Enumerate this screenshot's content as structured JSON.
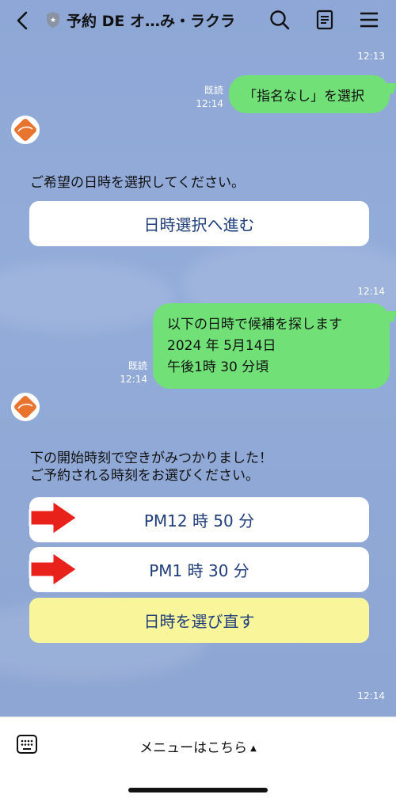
{
  "header": {
    "title": "予約 DE オ…み・ラクラ",
    "icons": [
      "back-icon",
      "shield-icon",
      "search-icon",
      "notes-icon",
      "menu-icon"
    ]
  },
  "messages": {
    "ts_top": "12:13",
    "sent1": {
      "read": "既読",
      "time": "12:14",
      "text": "「指名なし」を選択"
    },
    "bot1": {
      "text": "ご希望の日時を選択してください。",
      "button": "日時選択へ進む"
    },
    "ts_mid": "12:14",
    "sent2": {
      "read": "既読",
      "time": "12:14",
      "line1": "以下の日時で候補を探します",
      "line2": "2024 年 5月14日",
      "line3": "午後1時 30 分頃"
    },
    "bot2": {
      "line1": "下の開始時刻で空きがみつかりました！",
      "line2": "ご予約される時刻をお選びください。",
      "option1": "PM12 時 50 分",
      "option2": "PM1 時 30 分",
      "reselect": "日時を選び直す"
    },
    "ts_bottom": "12:14"
  },
  "bottom_bar": {
    "menu_label": "メニューはこちら",
    "caret": "▲"
  },
  "colors": {
    "chat_bg": "#8fa9d6",
    "sent_bubble": "#71e177",
    "button_text": "#1f3d7a",
    "reselect_bg": "#f8f59b",
    "arrow": "#e8211b",
    "logo": "#e8742f"
  }
}
